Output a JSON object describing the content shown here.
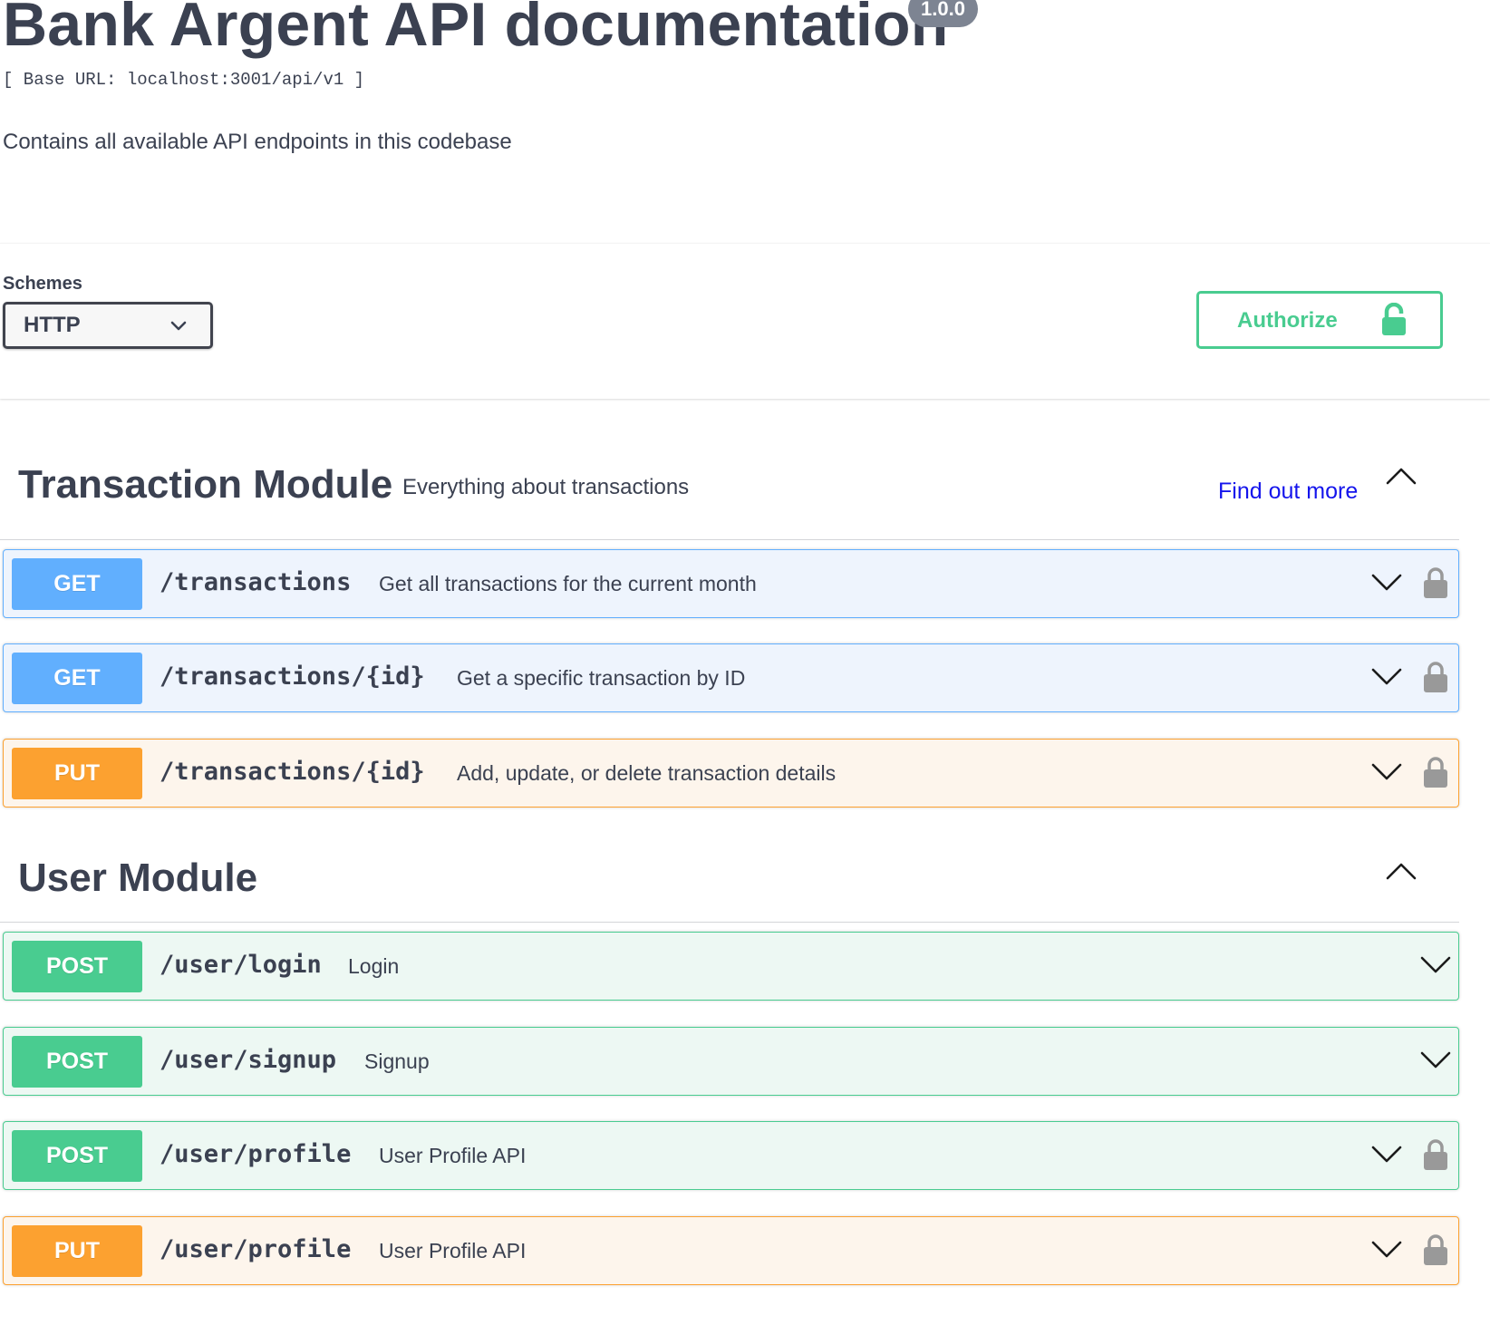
{
  "info": {
    "title": "Bank Argent API documentation",
    "version": "1.0.0",
    "base_url": "[ Base URL: localhost:3001/api/v1 ]",
    "description": "Contains all available API endpoints in this codebase"
  },
  "scheme_bar": {
    "schemes_label": "Schemes",
    "selected_scheme": "HTTP",
    "authorize_label": "Authorize"
  },
  "colors": {
    "get": "#61affe",
    "put": "#fca130",
    "post": "#49cc90",
    "authorize": "#49cc90",
    "link": "#1414ec"
  },
  "transaction_module": {
    "title": "Transaction Module",
    "description": "Everything about transactions",
    "find_out_more": "Find out more",
    "operations": [
      {
        "method": "GET",
        "path": "/transactions",
        "summary": "Get all transactions for the current month",
        "locked": true
      },
      {
        "method": "GET",
        "path": "/transactions/{id}",
        "summary": "Get a specific transaction by ID",
        "locked": true
      },
      {
        "method": "PUT",
        "path": "/transactions/{id}",
        "summary": "Add, update, or delete transaction details",
        "locked": true
      }
    ]
  },
  "user_module": {
    "title": "User Module",
    "operations": [
      {
        "method": "POST",
        "path": "/user/login",
        "summary": "Login",
        "locked": false
      },
      {
        "method": "POST",
        "path": "/user/signup",
        "summary": "Signup",
        "locked": false
      },
      {
        "method": "POST",
        "path": "/user/profile",
        "summary": "User Profile API",
        "locked": true
      },
      {
        "method": "PUT",
        "path": "/user/profile",
        "summary": "User Profile API",
        "locked": true
      }
    ]
  }
}
